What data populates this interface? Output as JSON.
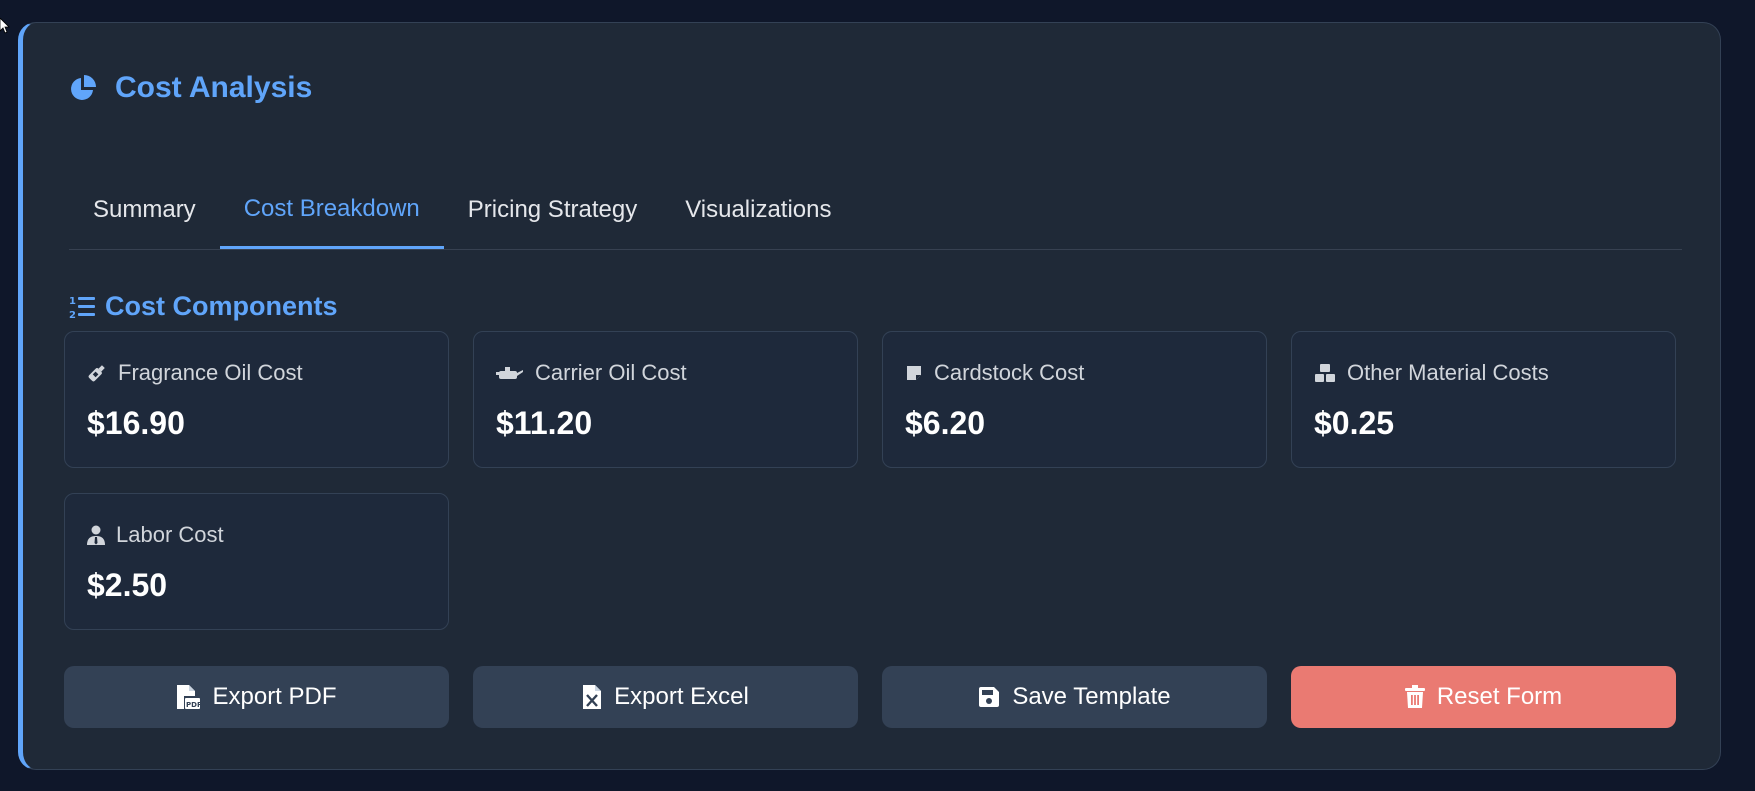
{
  "header": {
    "title": "Cost Analysis",
    "icon": "pie-chart-icon"
  },
  "tabs": [
    {
      "label": "Summary",
      "active": false
    },
    {
      "label": "Cost Breakdown",
      "active": true
    },
    {
      "label": "Pricing Strategy",
      "active": false
    },
    {
      "label": "Visualizations",
      "active": false
    }
  ],
  "section": {
    "title": "Cost Components",
    "icon": "numbered-list-icon"
  },
  "cards": [
    {
      "label": "Fragrance Oil Cost",
      "value": "$16.90",
      "icon": "bottle-icon"
    },
    {
      "label": "Carrier Oil Cost",
      "value": "$11.20",
      "icon": "oil-can-icon"
    },
    {
      "label": "Cardstock Cost",
      "value": "$6.20",
      "icon": "note-icon"
    },
    {
      "label": "Other Material Costs",
      "value": "$0.25",
      "icon": "boxes-icon"
    },
    {
      "label": "Labor Cost",
      "value": "$2.50",
      "icon": "user-tie-icon"
    }
  ],
  "actions": [
    {
      "label": "Export PDF",
      "icon": "file-pdf-icon"
    },
    {
      "label": "Export Excel",
      "icon": "file-excel-icon"
    },
    {
      "label": "Save Template",
      "icon": "floppy-disk-icon"
    },
    {
      "label": "Reset Form",
      "icon": "trash-icon"
    }
  ],
  "colors": {
    "accent": "#60a5fa",
    "page_bg": "#0f172a",
    "panel_bg": "#1f2937",
    "card_bg": "#1e293b",
    "button_bg": "#334155",
    "danger": "#ea7a72"
  }
}
